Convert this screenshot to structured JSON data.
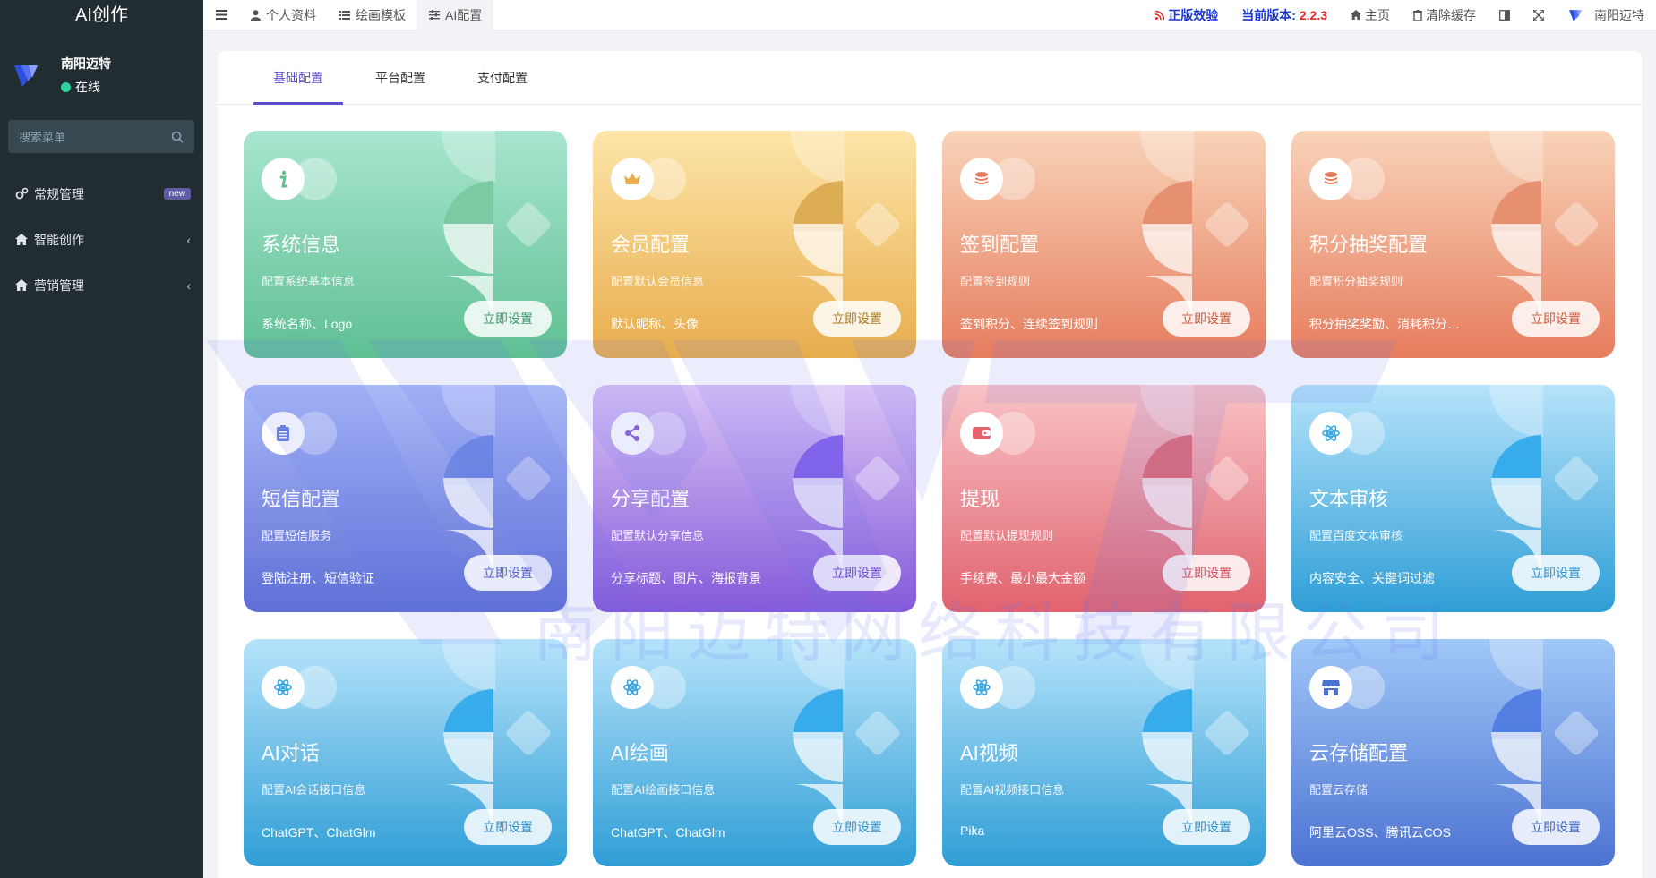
{
  "sidebar": {
    "brand": "AI创作",
    "user_name": "南阳迈特",
    "user_status": "在线",
    "search_placeholder": "搜索菜单",
    "items": [
      {
        "label": "常规管理",
        "badge": "new"
      },
      {
        "label": "智能创作",
        "chevron": "‹"
      },
      {
        "label": "营销管理",
        "chevron": "‹"
      }
    ]
  },
  "topbar": {
    "tabs": [
      {
        "label": "个人资料"
      },
      {
        "label": "绘画模板"
      },
      {
        "label": "AI配置"
      }
    ],
    "auth_label": "正版效验",
    "version_label": "当前版本:",
    "version_value": "2.2.3",
    "home_label": "主页",
    "clear_cache_label": "清除缓存",
    "user_label": "南阳迈特"
  },
  "content_tabs": [
    {
      "label": "基础配置"
    },
    {
      "label": "平台配置"
    },
    {
      "label": "支付配置"
    }
  ],
  "watermark_text": "南阳迈特网络科技有限公司",
  "cards": [
    {
      "title": "系统信息",
      "desc": "配置系统基本信息",
      "feat": "系统名称、Logo",
      "btn": "立即设置",
      "icon": "info-icon"
    },
    {
      "title": "会员配置",
      "desc": "配置默认会员信息",
      "feat": "默认昵称、头像",
      "btn": "立即设置",
      "icon": "crown-icon"
    },
    {
      "title": "签到配置",
      "desc": "配置签到规则",
      "feat": "签到积分、连续签到规则",
      "btn": "立即设置",
      "icon": "coins-icon"
    },
    {
      "title": "积分抽奖配置",
      "desc": "配置积分抽奖规则",
      "feat": "积分抽奖奖励、消耗积分…",
      "btn": "立即设置",
      "icon": "coins-icon"
    },
    {
      "title": "短信配置",
      "desc": "配置短信服务",
      "feat": "登陆注册、短信验证",
      "btn": "立即设置",
      "icon": "clipboard-icon"
    },
    {
      "title": "分享配置",
      "desc": "配置默认分享信息",
      "feat": "分享标题、图片、海报背景",
      "btn": "立即设置",
      "icon": "share-icon"
    },
    {
      "title": "提现",
      "desc": "配置默认提现规则",
      "feat": "手续费、最小最大金额",
      "btn": "立即设置",
      "icon": "wallet-icon"
    },
    {
      "title": "文本审核",
      "desc": "配置百度文本审核",
      "feat": "内容安全、关键词过滤",
      "btn": "立即设置",
      "icon": "atom-icon"
    },
    {
      "title": "AI对话",
      "desc": "配置AI会话接口信息",
      "feat": "ChatGPT、ChatGlm",
      "btn": "立即设置",
      "icon": "atom-icon"
    },
    {
      "title": "AI绘画",
      "desc": "配置AI绘画接口信息",
      "feat": "ChatGPT、ChatGlm",
      "btn": "立即设置",
      "icon": "atom-icon"
    },
    {
      "title": "AI视频",
      "desc": "配置AI视频接口信息",
      "feat": "Pika",
      "btn": "立即设置",
      "icon": "atom-icon"
    },
    {
      "title": "云存储配置",
      "desc": "配置云存储",
      "feat": "阿里云OSS、腾讯云COS",
      "btn": "立即设置",
      "icon": "store-icon"
    }
  ]
}
